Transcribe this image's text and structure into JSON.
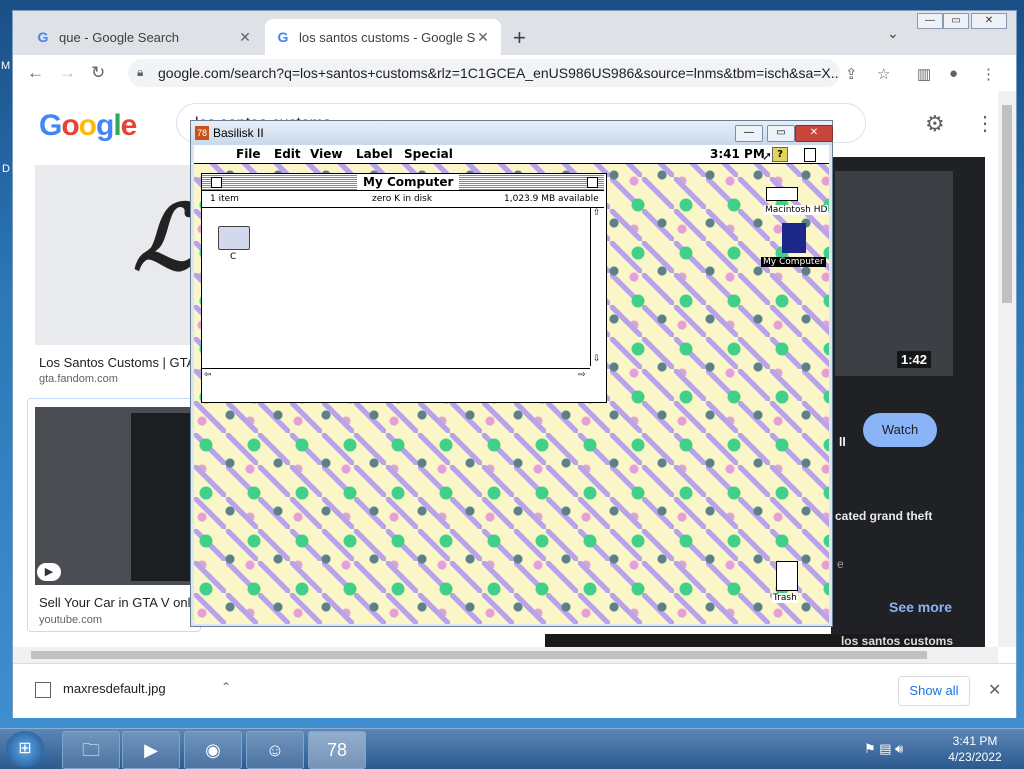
{
  "desktop": {
    "label_m": "M",
    "label_d": "D"
  },
  "chrome": {
    "tabs": [
      {
        "title": "que - Google Search",
        "icon": "G"
      },
      {
        "title": "los santos customs - Google Search",
        "icon": "G"
      }
    ],
    "new_tab": "+",
    "tab_menu": "⌄",
    "window_buttons": {
      "minimize": "—",
      "maximize": "▭",
      "close": "✕"
    },
    "url": "google.com/search?q=los+santos+customs&rlz=1C1GCEA_enUS986US986&source=lnms&tbm=isch&sa=X...",
    "nav": {
      "back": "←",
      "forward": "→",
      "reload": "↻"
    },
    "toolbar_icons": {
      "share": "⇪",
      "star": "☆",
      "sidebar": "▥",
      "profile": "●",
      "menu": "⋮"
    }
  },
  "google": {
    "logo_letters": [
      "G",
      "o",
      "o",
      "g",
      "l",
      "e"
    ],
    "logo_colors": [
      "#4285f4",
      "#ea4335",
      "#fbbc05",
      "#4285f4",
      "#34a853",
      "#ea4335"
    ],
    "search_query": "los santos customs",
    "results": [
      {
        "title": "Los Santos Customs | GTA",
        "source": "gta.fandom.com"
      },
      {
        "title": "Sell Your Car in GTA V onlin",
        "source": "youtube.com"
      }
    ],
    "video_panel": {
      "duration": "1:42",
      "watch_label": "Watch",
      "description": "cated grand theft",
      "see_more": "See more",
      "e_fragment": "e",
      "ii_fragment": "ll",
      "band_text": "los santos customs"
    }
  },
  "downloads": {
    "file_name": "maxresdefault.jpg",
    "show_all": "Show all",
    "close": "✕"
  },
  "basilisk": {
    "title": "Basilisk II",
    "menu": {
      "file": "File",
      "edit": "Edit",
      "view": "View",
      "label": "Label",
      "special": "Special"
    },
    "clock": "3:41 PM",
    "finder": {
      "title": "My Computer",
      "items_count": "1 item",
      "disk_info": "zero K in disk",
      "available": "1,023.9 MB available",
      "folder_name": "C"
    },
    "desktop_icons": {
      "hd": "Macintosh HD",
      "computer": "My Computer",
      "trash": "Trash"
    }
  },
  "taskbar": {
    "time": "3:41 PM",
    "date": "4/23/2022"
  }
}
